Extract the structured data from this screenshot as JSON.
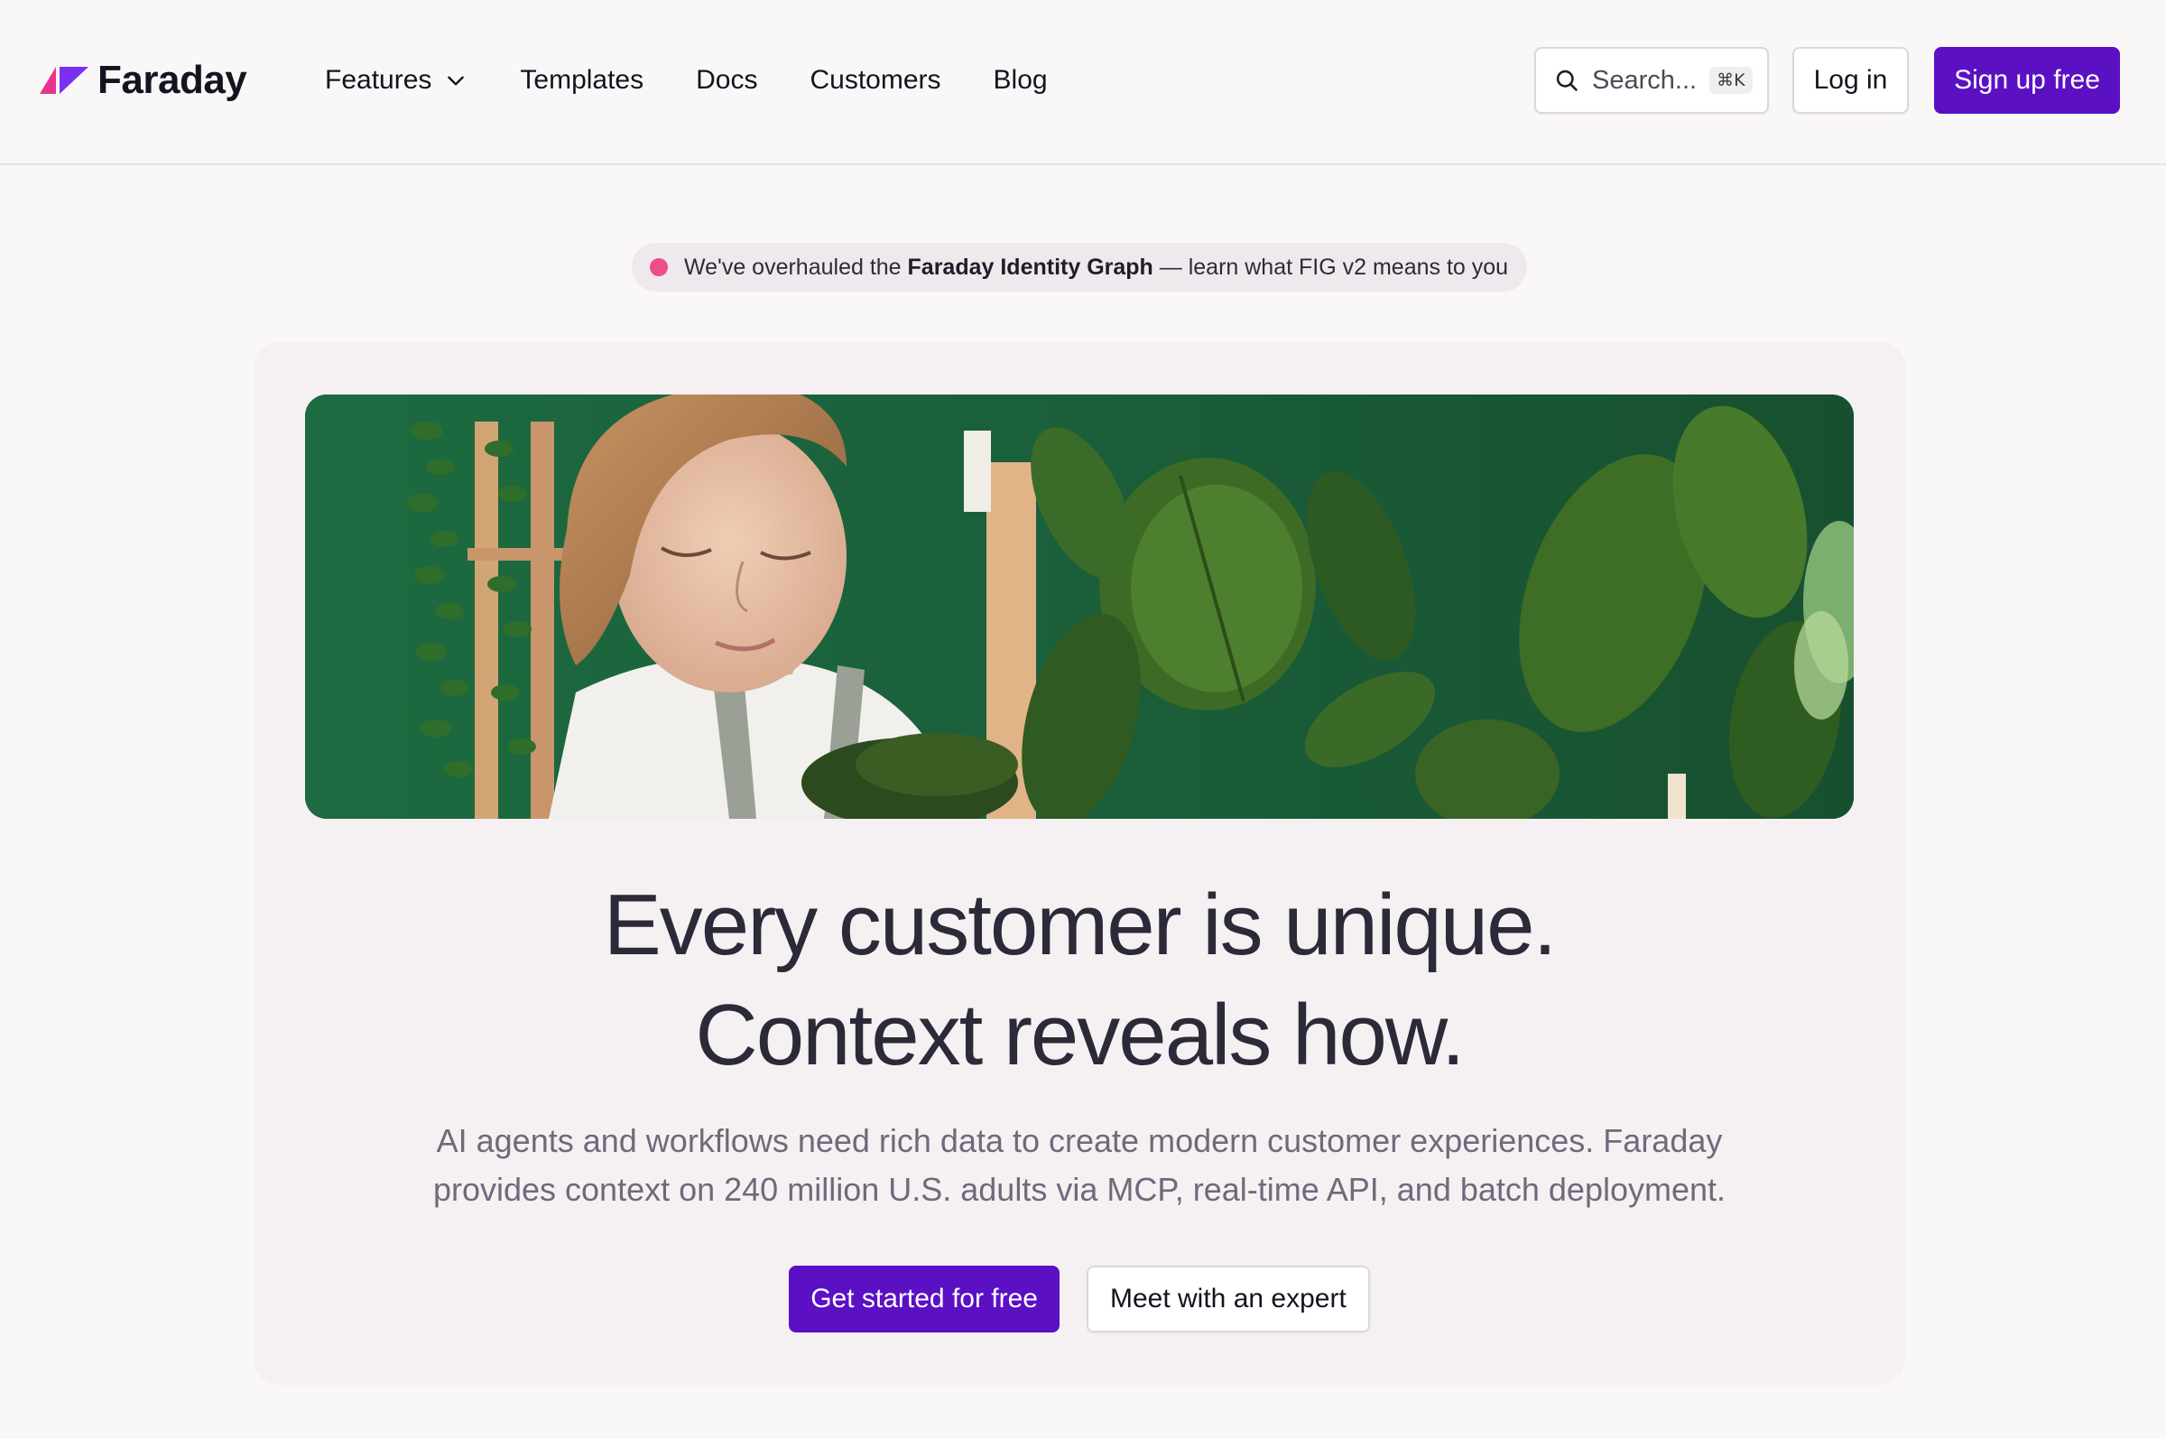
{
  "header": {
    "logo_text": "Faraday",
    "logo_icon": "faraday-logo-icon",
    "nav": [
      {
        "label": "Features",
        "has_dropdown": true
      },
      {
        "label": "Templates"
      },
      {
        "label": "Docs"
      },
      {
        "label": "Customers"
      },
      {
        "label": "Blog"
      }
    ],
    "search": {
      "placeholder": "Search...",
      "shortcut": "⌘K",
      "icon": "search-icon"
    },
    "login_label": "Log in",
    "signup_label": "Sign up free"
  },
  "announcement": {
    "prefix": "We've overhauled the ",
    "highlight": "Faraday Identity Graph",
    "suffix": " — learn what FIG v2 means to you",
    "dot_color": "#ee4d8b"
  },
  "hero": {
    "image_alt": "woman-with-plants",
    "headline_line1": "Every customer is unique.",
    "headline_line2": "Context reveals how.",
    "sub_line1": "AI agents and workflows need rich data to create modern customer experiences. Faraday",
    "sub_line2": "provides context on 240 million U.S. adults via MCP, real-time API, and batch deployment.",
    "cta_primary": "Get started for free",
    "cta_secondary": "Meet with an expert"
  },
  "colors": {
    "brand_purple": "#5b10c4",
    "logo_pink": "#e8348f",
    "logo_purple": "#7b2ff2",
    "background": "#faf7f8"
  }
}
